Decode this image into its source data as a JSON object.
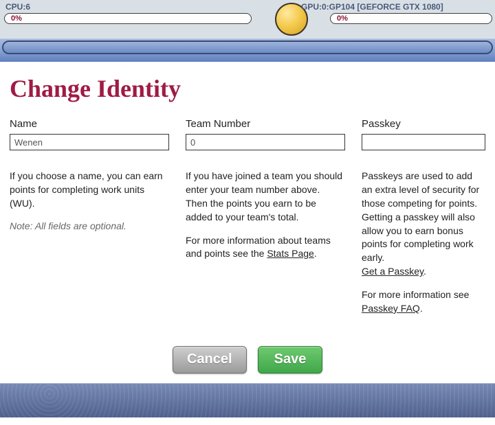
{
  "stats": {
    "cpu": {
      "label": "CPU:6",
      "pct": "0%"
    },
    "gpu": {
      "label": "GPU:0:GP104 [GEFORCE GTX 1080]",
      "pct": "0%"
    }
  },
  "title": "Change Identity",
  "fields": {
    "name": {
      "label": "Name",
      "value": "Wenen",
      "desc": "If you choose a name, you can earn points for completing work units (WU).",
      "note": "Note: All fields are optional."
    },
    "team": {
      "label": "Team Number",
      "value": "0",
      "desc1": "If you have joined a team you should enter your team number above.",
      "desc2": "Then the points you earn to be added to your team's total.",
      "desc3a": "For more information about teams and points see the ",
      "stats_link": "Stats Page",
      "desc3b": "."
    },
    "passkey": {
      "label": "Passkey",
      "value": "",
      "desc1": "Passkeys are used to add an extra level of security for those competing for points. Getting a passkey will also allow you to earn bonus points for completing work early.",
      "link1": "Get a Passkey",
      "desc2a": "For more information see ",
      "link2": "Passkey FAQ",
      "desc2b": "."
    }
  },
  "buttons": {
    "cancel": "Cancel",
    "save": "Save"
  }
}
